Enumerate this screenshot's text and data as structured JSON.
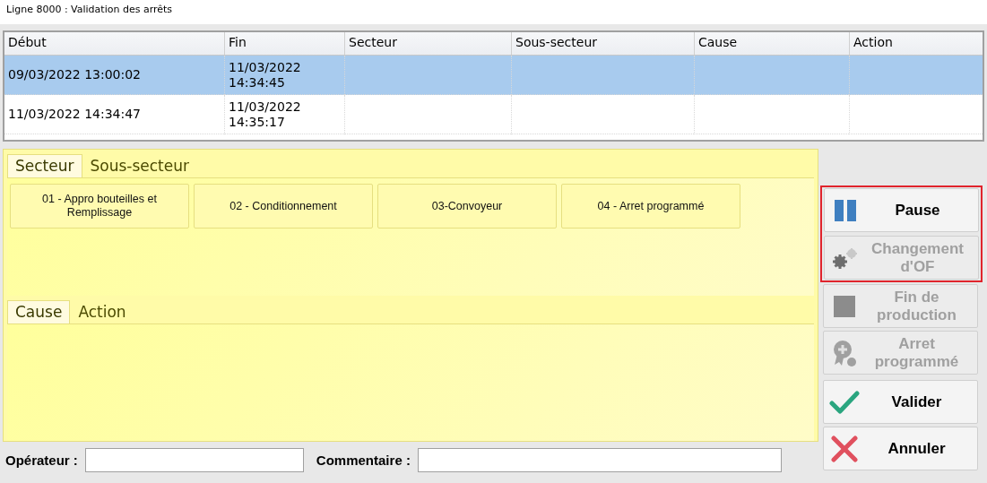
{
  "window": {
    "title": "Ligne 8000 : Validation des arrêts"
  },
  "table": {
    "columns": [
      "Début",
      "Fin",
      "Secteur",
      "Sous-secteur",
      "Cause",
      "Action"
    ],
    "rows": [
      {
        "selected": true,
        "cells": [
          "09/03/2022 13:00:02",
          "11/03/2022 14:34:45",
          "",
          "",
          "",
          ""
        ]
      },
      {
        "selected": false,
        "cells": [
          "11/03/2022 14:34:47",
          "11/03/2022 14:35:17",
          "",
          "",
          "",
          ""
        ]
      }
    ]
  },
  "sector_panel": {
    "tabs": [
      {
        "label": "Secteur",
        "selected": true
      },
      {
        "label": "Sous-secteur",
        "selected": false
      }
    ],
    "items": [
      "01 - Appro bouteilles et Remplissage",
      "02 - Conditionnement",
      "03-Convoyeur",
      "04 - Arret programmé"
    ]
  },
  "cause_panel": {
    "tabs": [
      {
        "label": "Cause",
        "selected": true
      },
      {
        "label": "Action",
        "selected": false
      }
    ]
  },
  "side_buttons": [
    {
      "kind": "pause",
      "label": "Pause",
      "disabled": false,
      "highlighted": true
    },
    {
      "kind": "change",
      "label": "Changement d'OF",
      "disabled": true,
      "highlighted": true
    },
    {
      "kind": "stop",
      "label": "Fin de production",
      "disabled": true,
      "highlighted": false
    },
    {
      "kind": "planned",
      "label": "Arret programmé",
      "disabled": true,
      "highlighted": false
    },
    {
      "kind": "validate",
      "label": "Valider",
      "disabled": false,
      "highlighted": false
    },
    {
      "kind": "cancel",
      "label": "Annuler",
      "disabled": false,
      "highlighted": false
    }
  ],
  "form": {
    "operator_label": "Opérateur :",
    "comment_label": "Commentaire :"
  }
}
